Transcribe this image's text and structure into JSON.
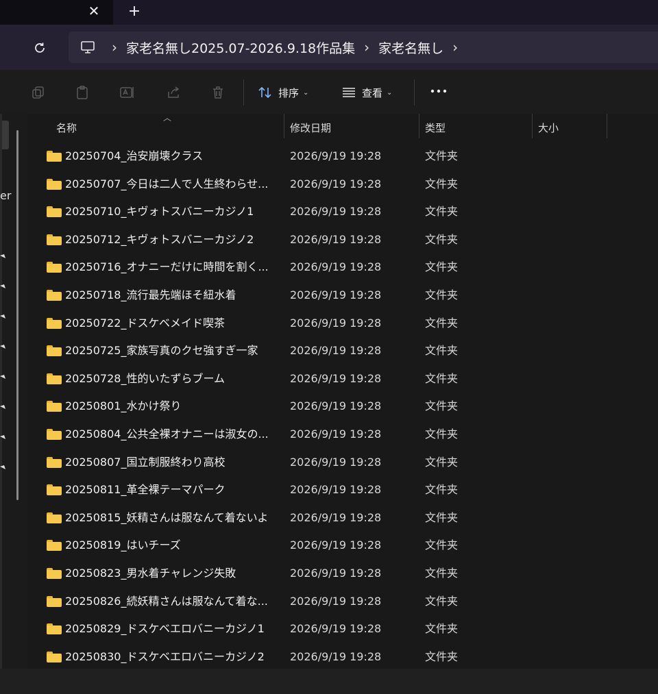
{
  "tabs": {
    "close_glyph": "✕",
    "new_tab_glyph": "+"
  },
  "address": {
    "icon": "this-pc-icon",
    "breadcrumbs": [
      "家老名無し2025.07-2026.9.18作品集",
      "家老名無し"
    ],
    "separator": "›"
  },
  "commandbar": {
    "icons": [
      "copy-icon",
      "paste-icon",
      "rename-icon",
      "share-icon",
      "delete-icon"
    ],
    "sort_label": "排序",
    "view_label": "查看",
    "more_glyph": "•••"
  },
  "nav": {
    "partial_text": "er"
  },
  "columns": {
    "name": "名称",
    "date": "修改日期",
    "type": "类型",
    "size": "大小"
  },
  "colors": {
    "folder": "#f6c84c",
    "background": "#191919",
    "address_bg": "#2f2a3b"
  },
  "files": [
    {
      "name": "20250704_治安崩壊クラス",
      "date": "2026/9/19 19:28",
      "type": "文件夹"
    },
    {
      "name": "20250707_今日は二人で人生終わらせ...",
      "date": "2026/9/19 19:28",
      "type": "文件夹"
    },
    {
      "name": "20250710_キヴォトスバニーカジノ1",
      "date": "2026/9/19 19:28",
      "type": "文件夹"
    },
    {
      "name": "20250712_キヴォトスバニーカジノ2",
      "date": "2026/9/19 19:28",
      "type": "文件夹"
    },
    {
      "name": "20250716_オナニーだけに時間を割く...",
      "date": "2026/9/19 19:28",
      "type": "文件夹"
    },
    {
      "name": "20250718_流行最先端ほそ紐水着",
      "date": "2026/9/19 19:28",
      "type": "文件夹"
    },
    {
      "name": "20250722_ドスケベメイド喫茶",
      "date": "2026/9/19 19:28",
      "type": "文件夹"
    },
    {
      "name": "20250725_家族写真のクセ強すぎ一家",
      "date": "2026/9/19 19:28",
      "type": "文件夹"
    },
    {
      "name": "20250728_性的いたずらブーム",
      "date": "2026/9/19 19:28",
      "type": "文件夹"
    },
    {
      "name": "20250801_水かけ祭り",
      "date": "2026/9/19 19:28",
      "type": "文件夹"
    },
    {
      "name": "20250804_公共全裸オナニーは淑女の...",
      "date": "2026/9/19 19:28",
      "type": "文件夹"
    },
    {
      "name": "20250807_国立制服終わり高校",
      "date": "2026/9/19 19:28",
      "type": "文件夹"
    },
    {
      "name": "20250811_革全裸テーマパーク",
      "date": "2026/9/19 19:28",
      "type": "文件夹"
    },
    {
      "name": "20250815_妖精さんは服なんて着ないよ",
      "date": "2026/9/19 19:28",
      "type": "文件夹"
    },
    {
      "name": "20250819_はいチーズ",
      "date": "2026/9/19 19:28",
      "type": "文件夹"
    },
    {
      "name": "20250823_男水着チャレンジ失敗",
      "date": "2026/9/19 19:28",
      "type": "文件夹"
    },
    {
      "name": "20250826_続妖精さんは服なんて着な...",
      "date": "2026/9/19 19:28",
      "type": "文件夹"
    },
    {
      "name": "20250829_ドスケベエロバニーカジノ1",
      "date": "2026/9/19 19:28",
      "type": "文件夹"
    },
    {
      "name": "20250830_ドスケベエロバニーカジノ2",
      "date": "2026/9/19 19:28",
      "type": "文件夹"
    }
  ]
}
